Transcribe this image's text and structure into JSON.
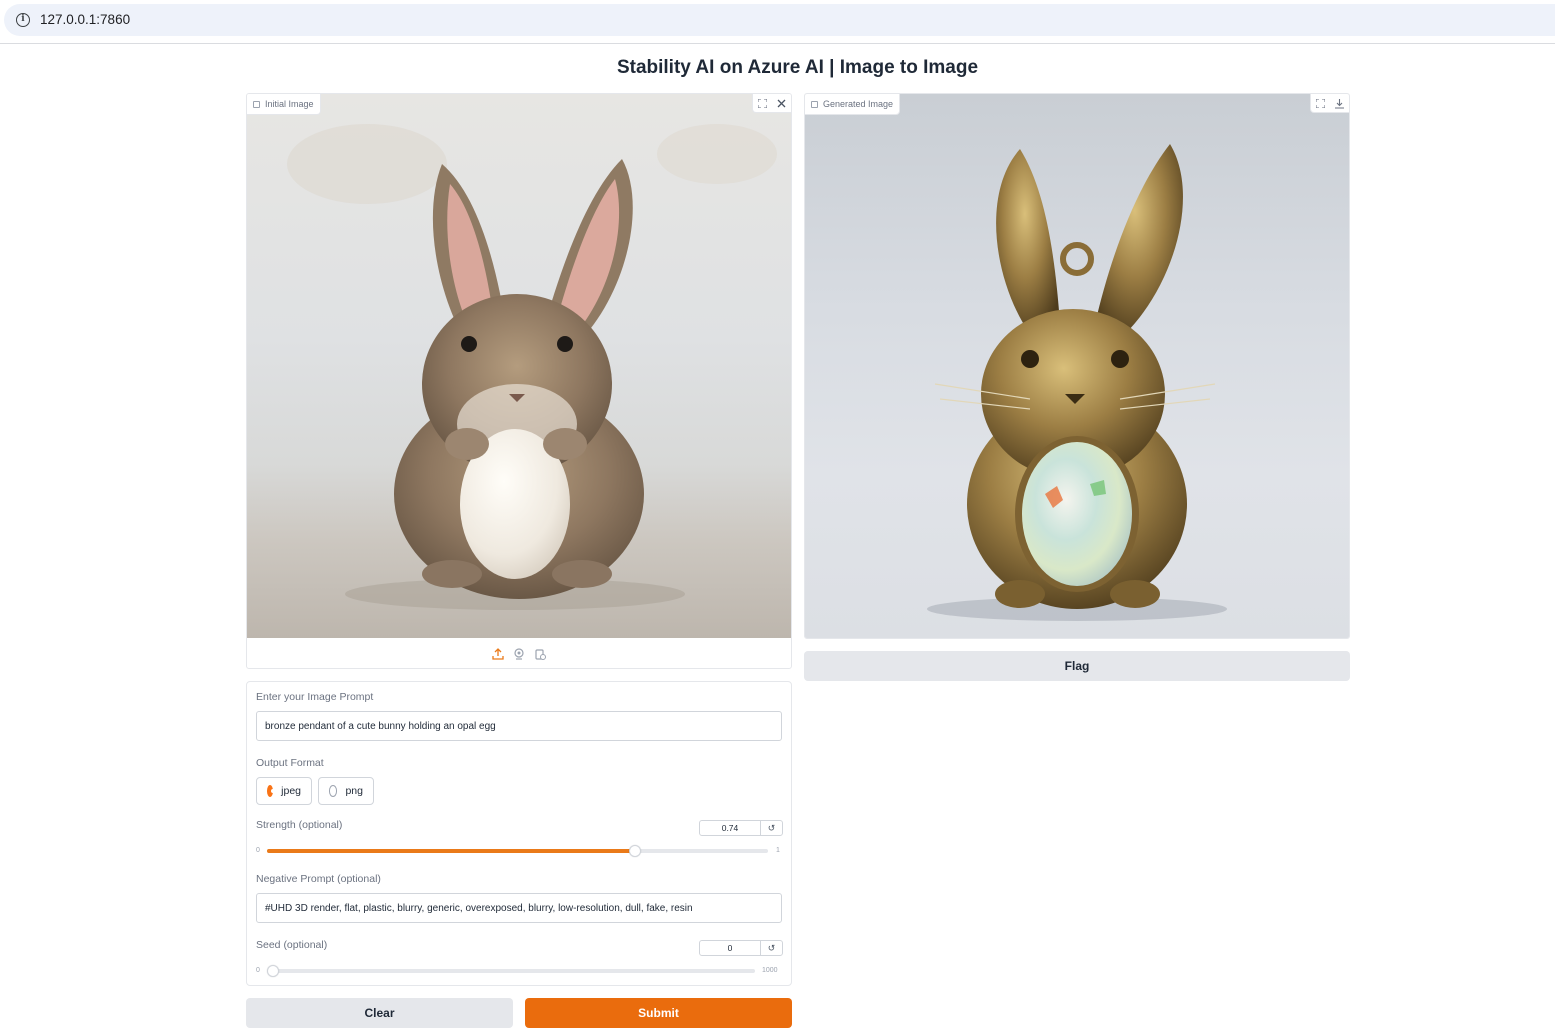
{
  "browser": {
    "url": "127.0.0.1:7860"
  },
  "page": {
    "title": "Stability AI on Azure AI | Image to Image"
  },
  "initial_image": {
    "label": "Initial Image",
    "source_icons": [
      "upload-icon",
      "webcam-icon",
      "clipboard-icon"
    ]
  },
  "generated_image": {
    "label": "Generated Image"
  },
  "flag_button": {
    "label": "Flag"
  },
  "form": {
    "prompt": {
      "label": "Enter your Image Prompt",
      "value": "bronze pendant of a cute bunny holding an opal egg"
    },
    "output_format": {
      "label": "Output Format",
      "options": [
        "jpeg",
        "png"
      ],
      "selected": "jpeg"
    },
    "strength": {
      "label": "Strength (optional)",
      "value": "0.74",
      "min": "0",
      "max": "1"
    },
    "negative_prompt": {
      "label": "Negative Prompt (optional)",
      "value": "#UHD 3D render, flat, plastic, blurry, generic, overexposed, blurry, low-resolution, dull, fake, resin"
    },
    "seed": {
      "label": "Seed (optional)",
      "value": "0",
      "min": "0",
      "max": "1000"
    }
  },
  "actions": {
    "clear_label": "Clear",
    "submit_label": "Submit"
  },
  "colors": {
    "accent": "#ea6c0d",
    "neutral_button": "#e5e7eb"
  }
}
